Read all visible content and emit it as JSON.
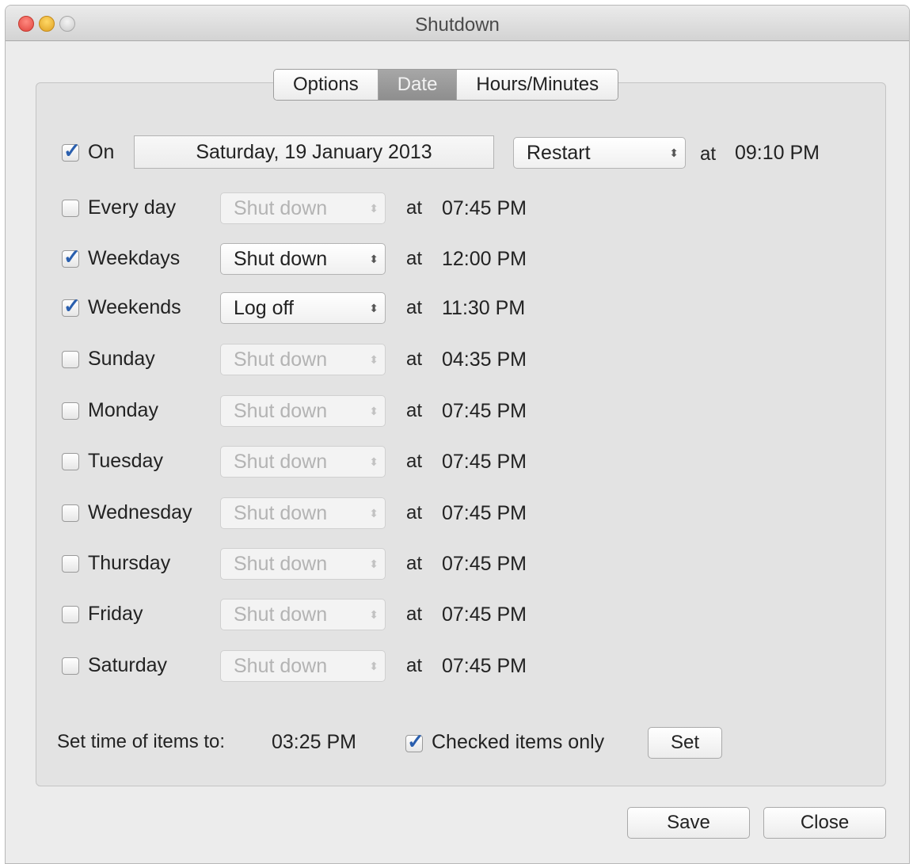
{
  "window": {
    "title": "Shutdown"
  },
  "tabs": [
    {
      "label": "Options",
      "selected": false
    },
    {
      "label": "Date",
      "selected": true
    },
    {
      "label": "Hours/Minutes",
      "selected": false
    }
  ],
  "on_row": {
    "label": "On",
    "checked": true,
    "date": "Saturday, 19 January 2013",
    "action": "Restart",
    "at_label": "at",
    "time": "09:10 PM"
  },
  "schedule": [
    {
      "label": "Every day",
      "checked": false,
      "action": "Shut down",
      "at": "at",
      "time": "07:45 PM"
    },
    {
      "label": "Weekdays",
      "checked": true,
      "action": "Shut down",
      "at": "at",
      "time": "12:00 PM"
    },
    {
      "label": "Weekends",
      "checked": true,
      "action": "Log off",
      "at": "at",
      "time": "11:30 PM"
    },
    {
      "label": "Sunday",
      "checked": false,
      "action": "Shut down",
      "at": "at",
      "time": "04:35 PM"
    },
    {
      "label": "Monday",
      "checked": false,
      "action": "Shut down",
      "at": "at",
      "time": "07:45 PM"
    },
    {
      "label": "Tuesday",
      "checked": false,
      "action": "Shut down",
      "at": "at",
      "time": "07:45 PM"
    },
    {
      "label": "Wednesday",
      "checked": false,
      "action": "Shut down",
      "at": "at",
      "time": "07:45 PM"
    },
    {
      "label": "Thursday",
      "checked": false,
      "action": "Shut down",
      "at": "at",
      "time": "07:45 PM"
    },
    {
      "label": "Friday",
      "checked": false,
      "action": "Shut down",
      "at": "at",
      "time": "07:45 PM"
    },
    {
      "label": "Saturday",
      "checked": false,
      "action": "Shut down",
      "at": "at",
      "time": "07:45 PM"
    }
  ],
  "set_time": {
    "label": "Set time of items to:",
    "time": "03:25 PM",
    "checked_only_label": "Checked items only",
    "checked_only": true,
    "set_label": "Set"
  },
  "footer": {
    "save_label": "Save",
    "close_label": "Close"
  },
  "icons": {
    "checkmark": "checkmark-icon",
    "stepper": "up-down-arrows-icon"
  },
  "colors": {
    "check_blue": "#2a5fae",
    "selected_tab": "#9a9a9a"
  }
}
